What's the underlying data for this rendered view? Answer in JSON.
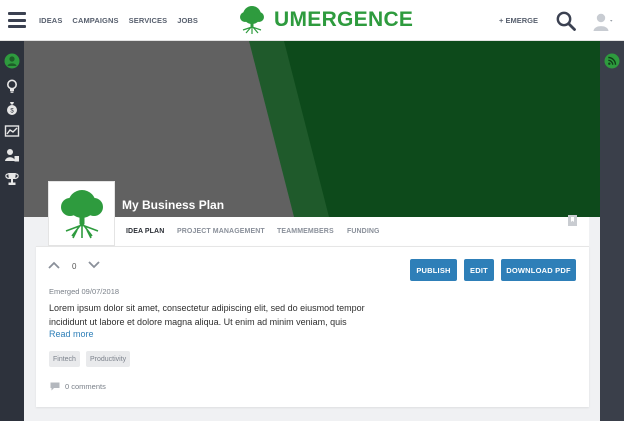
{
  "header": {
    "nav": [
      "IDEAS",
      "CAMPAIGNS",
      "SERVICES",
      "JOBS"
    ],
    "logo_text": "UMERGENCE",
    "emerge_label": "+ EMERGE"
  },
  "sidebar": {
    "icons": [
      "user-circle-icon",
      "lightbulb-icon",
      "money-bag-icon",
      "chart-icon",
      "user-admin-icon",
      "trophy-icon"
    ]
  },
  "right_rail": {
    "icon": "rss-icon"
  },
  "idea": {
    "title": "My Business Plan",
    "tabs": [
      "IDEA PLAN",
      "PROJECT MANAGEMENT",
      "TEAMMEMBERS",
      "FUNDING"
    ],
    "active_tab": "IDEA PLAN",
    "votes": "0",
    "buttons": {
      "publish": "PUBLISH",
      "edit": "EDIT",
      "download": "DOWNLOAD PDF"
    },
    "emerged": "Emerged 09/07/2018",
    "description": "Lorem ipsum dolor sit amet, consectetur adipiscing elit, sed do eiusmod tempor incididunt ut labore et dolore magna aliqua. Ut enim ad minim veniam, quis",
    "read_more": "Read more",
    "tags": [
      "Fintech",
      "Productivity"
    ],
    "comments": "0 comments"
  },
  "colors": {
    "brand_green": "#2e9b3e",
    "dark_green": "#0f4a1c",
    "button_blue": "#2e7fb8",
    "sidebar": "#2d323c"
  }
}
